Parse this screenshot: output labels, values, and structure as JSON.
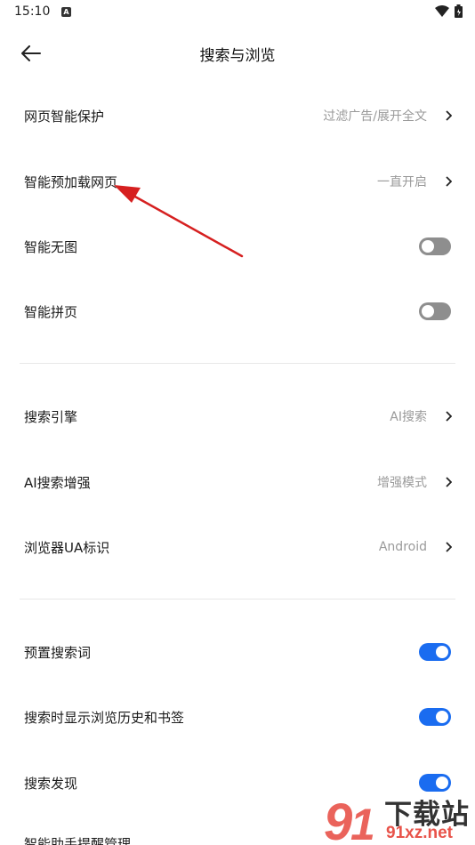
{
  "status": {
    "time": "15:10",
    "badge": "A"
  },
  "app_bar": {
    "title": "搜索与浏览"
  },
  "section1": {
    "web_protection": {
      "label": "网页智能保护",
      "value": "过滤广告/展开全文"
    },
    "preload": {
      "label": "智能预加载网页",
      "value": "一直开启"
    },
    "no_image": {
      "label": "智能无图",
      "toggle": "off"
    },
    "page_merge": {
      "label": "智能拼页",
      "toggle": "off"
    }
  },
  "section2": {
    "search_engine": {
      "label": "搜索引擎",
      "value": "AI搜索"
    },
    "ai_enhance": {
      "label": "AI搜索增强",
      "value": "增强模式"
    },
    "ua": {
      "label": "浏览器UA标识",
      "value": "Android"
    }
  },
  "section3": {
    "preset_words": {
      "label": "预置搜索词",
      "toggle": "on"
    },
    "show_history": {
      "label": "搜索时显示浏览历史和书签",
      "toggle": "on"
    },
    "discover": {
      "label": "搜索发现",
      "toggle": "on"
    },
    "partial_label": "智能助手提醒管理"
  },
  "watermark": {
    "brand": "下载站",
    "domain": "91xz.net"
  },
  "colors": {
    "accent": "#1a6cf0",
    "toggle_off": "#8e8e8e",
    "annotation_arrow": "#d62020"
  }
}
